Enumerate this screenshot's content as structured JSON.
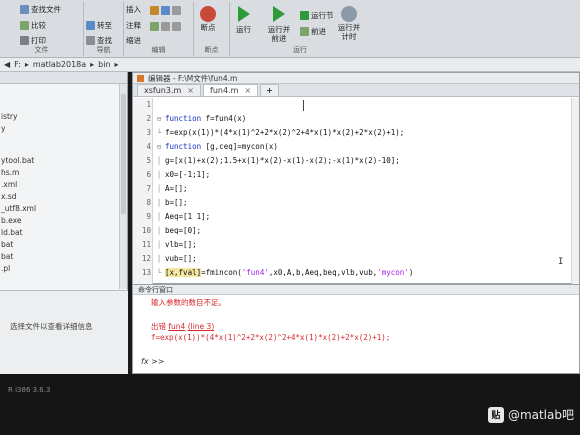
{
  "ribbon": {
    "file_group": {
      "find_files": "查找文件",
      "compare": "比较",
      "print": "打印",
      "label": "文件"
    },
    "nav_group": {
      "goto": "转至",
      "find": "查找",
      "label": "导航"
    },
    "edit_group": {
      "insert": "插入",
      "comment": "注释",
      "indent": "缩进",
      "label": "编辑"
    },
    "breakpoints_group": {
      "breakpoints": "断点",
      "label": "断点"
    },
    "run_group": {
      "run": "运行",
      "run_and_advance": "运行并\n前进",
      "run_section": "运行节",
      "advance": "前进",
      "run_and_time": "运行并\n计时",
      "label": "运行"
    }
  },
  "pathbar": {
    "drive": "F:",
    "folder1": "matlab2018a",
    "folder2": "bin"
  },
  "left_panel": {
    "files": [
      "istry",
      "y",
      "ytool.bat",
      "hs.m",
      ".xml",
      "x.sd",
      "_utf8.xml",
      "b.exe",
      "ld.bat",
      "bat",
      "bat",
      ".pl"
    ],
    "detail_text": "选择文件以查看详细信息"
  },
  "editor": {
    "title": "编辑器 - F:\\M文件\\fun4.m",
    "tabs": [
      {
        "label": "xsfun3.m",
        "active": false
      },
      {
        "label": "fun4.m",
        "active": true
      },
      {
        "label": "+",
        "active": false
      }
    ],
    "lines": [
      {
        "n": "1",
        "fold": "",
        "code": ""
      },
      {
        "n": "2",
        "fold": "⊟",
        "kw": "function",
        "code": " f=fun4(x)"
      },
      {
        "n": "3",
        "fold": "└",
        "code": "f=exp(x(1))*(4*x(1)^2+2*x(2)^2+4*x(1)*x(2)+2*x(2)+1);"
      },
      {
        "n": "4",
        "fold": "⊟",
        "kw": "function",
        "code": " [g,ceq]=mycon(x)"
      },
      {
        "n": "5",
        "fold": "│",
        "code": "g=[x(1)+x(2);1.5+x(1)*x(2)-x(1)-x(2);-x(1)*x(2)-10];"
      },
      {
        "n": "6",
        "fold": "│",
        "code": "x0=[-1;1];"
      },
      {
        "n": "7",
        "fold": "│",
        "code": "A=[];"
      },
      {
        "n": "8",
        "fold": "│",
        "code": "b=[];"
      },
      {
        "n": "9",
        "fold": "│",
        "code": "Aeq=[1 1];"
      },
      {
        "n": "10",
        "fold": "│",
        "code": "beq=[0];"
      },
      {
        "n": "11",
        "fold": "│",
        "code": "vlb=[];"
      },
      {
        "n": "12",
        "fold": "│",
        "code": "vub=[];"
      },
      {
        "n": "13",
        "fold": "└",
        "hl": "[x,fval]",
        "code": "=fmincon('fun4',x0,A,b,Aeq,beq,vlb,vub,'mycon')",
        "str1": "'fun4'",
        "str2": "'mycon'"
      }
    ]
  },
  "command_window": {
    "title": "命令行窗口",
    "error_line": "输入参数的数目不足。",
    "error_in_prefix": "出错",
    "error_in_func": "fun4",
    "error_in_line": "(line 3)",
    "error_code": "f=exp(x(1))*(4*x(1)^2+2*x(2)^2+4*x(1)*x(2)+2*x(2)+1);",
    "prompt": "fx >>"
  },
  "status": {
    "text": "R i386 3.6.3"
  },
  "watermark": {
    "logo": "贴",
    "text": "@matlab吧"
  },
  "colors": {
    "keyword": "#1530c8",
    "string": "#a020f0",
    "error": "#d8262d",
    "highlight": "#f4e6a0"
  }
}
